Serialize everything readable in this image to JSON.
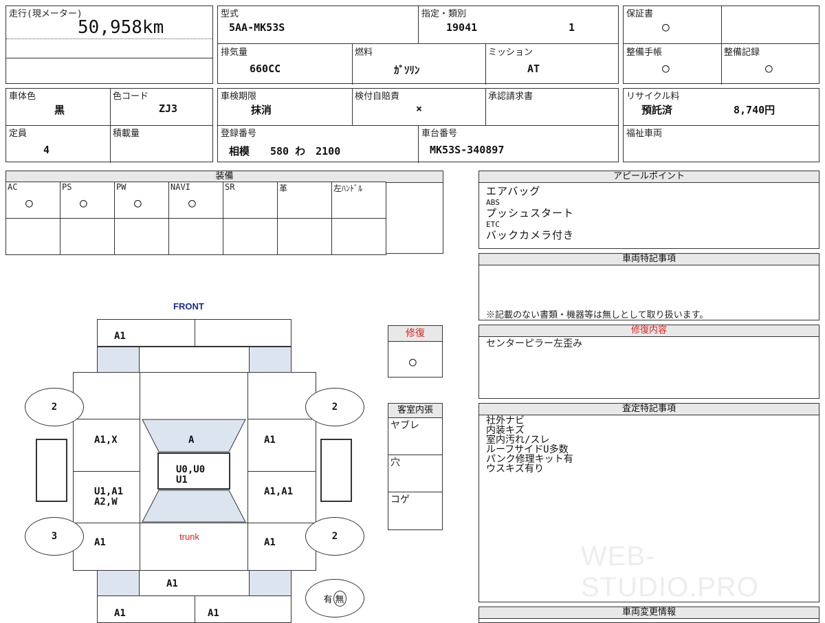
{
  "top_info": {
    "mileage_label": "走行(現メーター)",
    "mileage_value": "50,958km",
    "model_label": "型式",
    "model_value": "5AA-MK53S",
    "designation_label": "指定・類別",
    "designation_value": "19041",
    "class_value": "1",
    "warranty_label": "保証書",
    "warranty_value": "○",
    "displacement_label": "排気量",
    "displacement_value": "660CC",
    "fuel_label": "燃料",
    "fuel_value": "ｶﾞｿﾘﾝ",
    "mission_label": "ミッション",
    "mission_value": "AT",
    "maintenance_book_label": "整備手帳",
    "maintenance_book_value": "○",
    "maintenance_record_label": "整備記録",
    "maintenance_record_value": "○",
    "color_label": "車体色",
    "color_value": "黒",
    "color_code_label": "色コード",
    "color_code_value": "ZJ3",
    "inspection_label": "車検期限",
    "inspection_value": "抹消",
    "insurance_label": "検付自賠責",
    "insurance_value": "×",
    "approval_label": "承認請求書",
    "recycle_label": "リサイクル料",
    "recycle_status": "預託済",
    "recycle_amount": "8,740円",
    "capacity_label": "定員",
    "capacity_value": "4",
    "load_label": "積載量",
    "registration_label": "登録番号",
    "registration_value": "相模　　580 わ　2100",
    "chassis_label": "車台番号",
    "chassis_value": "MK53S-340897",
    "welfare_label": "福祉車両"
  },
  "equipment": {
    "title": "装備",
    "items": [
      {
        "label": "AC",
        "value": "○"
      },
      {
        "label": "PS",
        "value": "○"
      },
      {
        "label": "PW",
        "value": "○"
      },
      {
        "label": "NAVI",
        "value": "○"
      },
      {
        "label": "SR",
        "value": ""
      },
      {
        "label": "革",
        "value": ""
      },
      {
        "label": "左ﾊﾝﾄﾞﾙ",
        "value": ""
      }
    ]
  },
  "appeal": {
    "title": "アピールポイント",
    "items": [
      "エアバッグ",
      "ABS",
      "プッシュスタート",
      "ETC",
      "バックカメラ付き"
    ]
  },
  "special_notes": {
    "title": "車両特記事項",
    "footnote": "※記載のない書類・機器等は無しとして取り扱います。"
  },
  "repair": {
    "title": "修復",
    "value": "○"
  },
  "repair_details": {
    "title": "修復内容",
    "text": "センターピラー左歪み"
  },
  "interior": {
    "title": "客室内張",
    "items": [
      "ヤブレ",
      "穴",
      "コゲ"
    ]
  },
  "assessment": {
    "title": "査定特記事項",
    "items": [
      "社外ナビ",
      "内装キズ",
      "室内汚れ/スレ",
      "ルーフサイドU多数",
      "パンク修理キット有",
      "ウスキズ有り"
    ]
  },
  "change_info": {
    "title": "車両変更情報"
  },
  "diagram": {
    "front_label": "FRONT",
    "trunk_label": "trunk",
    "front_bumper_left": "A1",
    "hood_left": "",
    "left_front_fender": "",
    "left_front_door": "A1,X",
    "windshield": "A",
    "roof_line1": "U0,U0",
    "roof_line2": "U1",
    "right_front_door": "A1",
    "left_rear_door_line1": "U1,A1",
    "left_rear_door_line2": "A2,W",
    "right_rear_door": "A1,A1",
    "left_rear_fender": "A1",
    "right_rear_fender": "A1",
    "rear_panel": "A1",
    "rear_bumper_left": "A1",
    "rear_bumper_right": "A1",
    "tire_fl": "2",
    "tire_fr": "2",
    "tire_rl": "3",
    "tire_rr": "2",
    "spare_label_left": "有",
    "spare_label_right": "無"
  },
  "watermark": "WEB-STUDIO.PRO"
}
